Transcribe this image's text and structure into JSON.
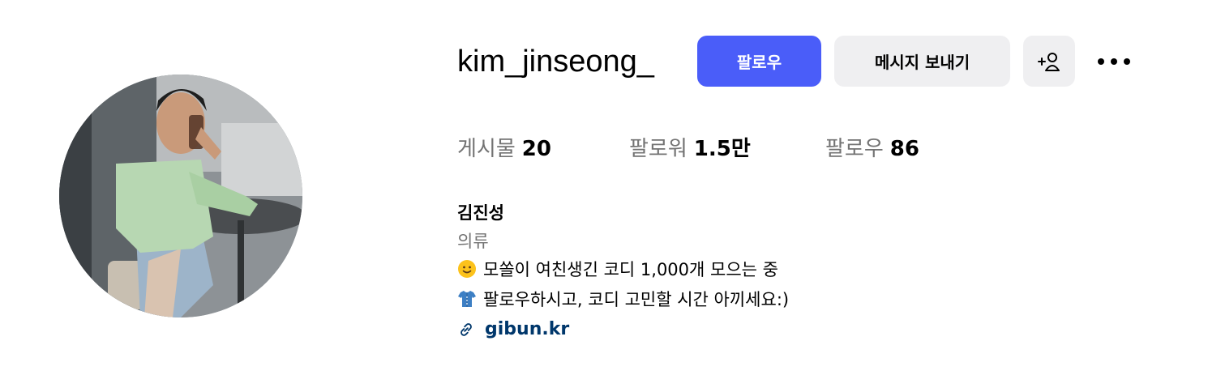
{
  "profile": {
    "username": "kim_jinseong_",
    "avatar_icon": "profile-photo",
    "actions": {
      "follow_label": "팔로우",
      "message_label": "메시지 보내기",
      "suggest_icon": "add-user-icon",
      "more_icon": "more-options-icon"
    },
    "stats": {
      "posts_label": "게시물",
      "posts_value": "20",
      "followers_label": "팔로워",
      "followers_value": "1.5만",
      "following_label": "팔로우",
      "following_value": "86"
    },
    "bio": {
      "name": "김진성",
      "category": "의류",
      "line1_emoji": "slightly-smiling-face-icon",
      "line1": "모쏠이 여친생긴 코디 1,000개 모으는 중",
      "line2_emoji": "t-shirt-icon",
      "line2": "팔로우하시고, 코디 고민할 시간 아끼세요:)",
      "link_icon": "link-icon",
      "link_text": "gibun.kr"
    }
  },
  "colors": {
    "accent": "#4a5df9",
    "secondary_button": "#efeff1",
    "muted_text": "#737373",
    "link_text": "#00376b"
  }
}
